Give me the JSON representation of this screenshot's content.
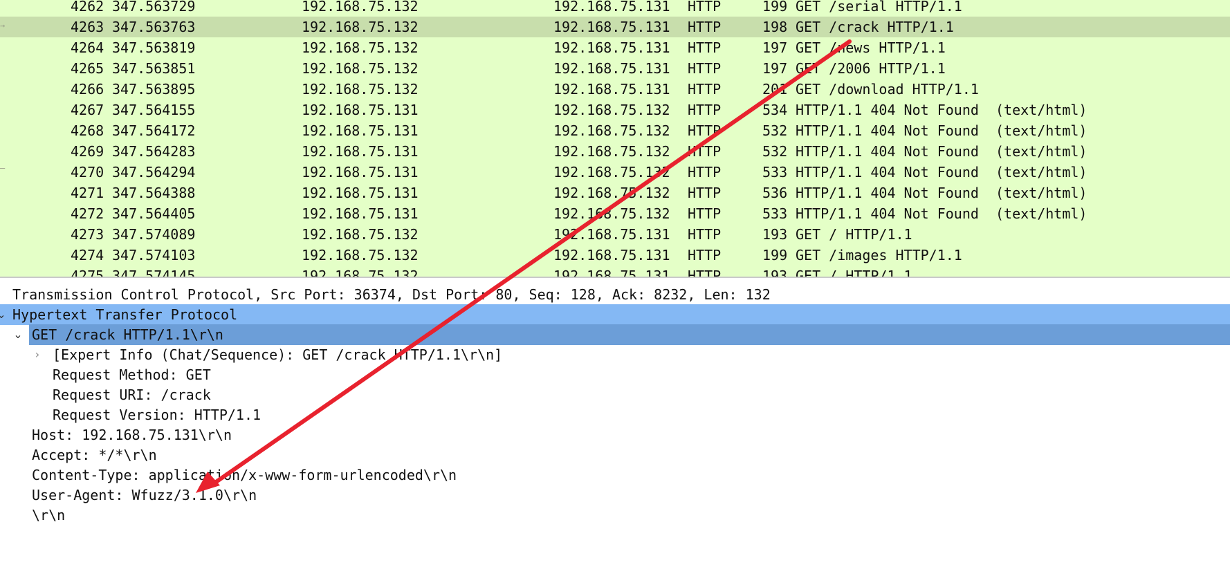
{
  "packets": [
    {
      "no": "4262",
      "time": "347.563729",
      "src": "192.168.75.132",
      "dst": "192.168.75.131",
      "proto": "HTTP",
      "len": "199",
      "info": "GET /serial HTTP/1.1"
    },
    {
      "no": "4263",
      "time": "347.563763",
      "src": "192.168.75.132",
      "dst": "192.168.75.131",
      "proto": "HTTP",
      "len": "198",
      "info": "GET /crack HTTP/1.1",
      "selected": true
    },
    {
      "no": "4264",
      "time": "347.563819",
      "src": "192.168.75.132",
      "dst": "192.168.75.131",
      "proto": "HTTP",
      "len": "197",
      "info": "GET /news HTTP/1.1"
    },
    {
      "no": "4265",
      "time": "347.563851",
      "src": "192.168.75.132",
      "dst": "192.168.75.131",
      "proto": "HTTP",
      "len": "197",
      "info": "GET /2006 HTTP/1.1"
    },
    {
      "no": "4266",
      "time": "347.563895",
      "src": "192.168.75.132",
      "dst": "192.168.75.131",
      "proto": "HTTP",
      "len": "201",
      "info": "GET /download HTTP/1.1"
    },
    {
      "no": "4267",
      "time": "347.564155",
      "src": "192.168.75.131",
      "dst": "192.168.75.132",
      "proto": "HTTP",
      "len": "534",
      "info": "HTTP/1.1 404 Not Found  (text/html)"
    },
    {
      "no": "4268",
      "time": "347.564172",
      "src": "192.168.75.131",
      "dst": "192.168.75.132",
      "proto": "HTTP",
      "len": "532",
      "info": "HTTP/1.1 404 Not Found  (text/html)"
    },
    {
      "no": "4269",
      "time": "347.564283",
      "src": "192.168.75.131",
      "dst": "192.168.75.132",
      "proto": "HTTP",
      "len": "532",
      "info": "HTTP/1.1 404 Not Found  (text/html)"
    },
    {
      "no": "4270",
      "time": "347.564294",
      "src": "192.168.75.131",
      "dst": "192.168.75.132",
      "proto": "HTTP",
      "len": "533",
      "info": "HTTP/1.1 404 Not Found  (text/html)"
    },
    {
      "no": "4271",
      "time": "347.564388",
      "src": "192.168.75.131",
      "dst": "192.168.75.132",
      "proto": "HTTP",
      "len": "536",
      "info": "HTTP/1.1 404 Not Found  (text/html)"
    },
    {
      "no": "4272",
      "time": "347.564405",
      "src": "192.168.75.131",
      "dst": "192.168.75.132",
      "proto": "HTTP",
      "len": "533",
      "info": "HTTP/1.1 404 Not Found  (text/html)"
    },
    {
      "no": "4273",
      "time": "347.574089",
      "src": "192.168.75.132",
      "dst": "192.168.75.131",
      "proto": "HTTP",
      "len": "193",
      "info": "GET / HTTP/1.1"
    },
    {
      "no": "4274",
      "time": "347.574103",
      "src": "192.168.75.132",
      "dst": "192.168.75.131",
      "proto": "HTTP",
      "len": "199",
      "info": "GET /images HTTP/1.1"
    },
    {
      "no": "4275",
      "time": "347.574145",
      "src": "192.168.75.132",
      "dst": "192.168.75.131",
      "proto": "HTTP",
      "len": "193",
      "info": "GET / HTTP/1.1"
    }
  ],
  "details": {
    "tcp": "Transmission Control Protocol, Src Port: 36374, Dst Port: 80, Seq: 128, Ack: 8232, Len: 132",
    "http": "Hypertext Transfer Protocol",
    "get_line": "GET /crack HTTP/1.1\\r\\n",
    "expert_info": "[Expert Info (Chat/Sequence): GET /crack HTTP/1.1\\r\\n]",
    "request_method": "Request Method: GET",
    "request_uri": "Request URI: /crack",
    "request_version": "Request Version: HTTP/1.1",
    "host": "Host: 192.168.75.131\\r\\n",
    "accept": "Accept: */*\\r\\n",
    "content_type": "Content-Type: application/x-www-form-urlencoded\\r\\n",
    "user_agent": "User-Agent: Wfuzz/3.1.0\\r\\n",
    "end": "\\r\\n"
  },
  "colors": {
    "packet_bg": "#e4ffc7",
    "selected_row": "#c8deac",
    "http_highlight": "#84b8f4",
    "get_highlight": "#6c9ed8",
    "arrow": "#e8222e"
  },
  "icons": {
    "expanded": "chevron-down-icon",
    "collapsed": "chevron-right-icon"
  }
}
